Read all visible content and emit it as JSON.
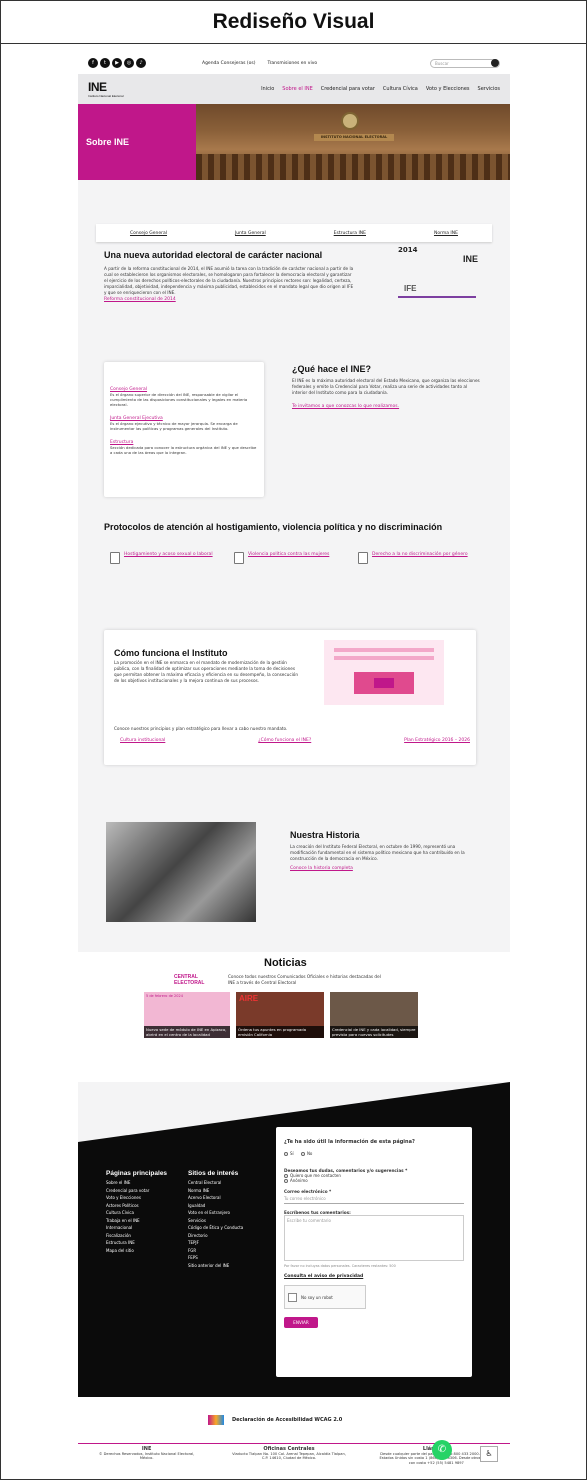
{
  "title": "Rediseño Visual",
  "utility": {
    "social_icons": [
      "facebook-icon",
      "twitter-icon",
      "youtube-icon",
      "instagram-icon",
      "tiktok-icon"
    ],
    "links": [
      "Agenda Consejeras (os)",
      "Transmisiones en vivo"
    ],
    "search_placeholder": "Buscar"
  },
  "nav": {
    "logo": "INE",
    "logo_sub": "Instituto Nacional Electoral",
    "items": [
      "Inicio",
      "Sobre el INE",
      "Credencial para votar",
      "Cultura Cívica",
      "Voto y Elecciones",
      "Servicios"
    ]
  },
  "hero": {
    "title": "Sobre INE",
    "banner_text": "INSTITUTO NACIONAL ELECTORAL"
  },
  "subtabs": [
    "Consejo General",
    "Junta General",
    "Estructura INE",
    "Norma INE"
  ],
  "intro": {
    "title": "Una nueva autoridad electoral de carácter nacional",
    "body": "A partir de la reforma constitucional de 2014, el INE asumió la tarea con la tradición de carácter nacional a partir de la cual se establecieron los organismos electorales, se homologaron para fortalecer la democracia electoral y garantizar el ejercicio de los derechos políticos-electorales de la ciudadanía. Nuestros principios rectores son: legalidad, certeza, imparcialidad, objetividad, independencia y máxima publicidad, establecidos en el mandato legal que dio origen al IFE y que se enriquecieron con el INE.",
    "link": "Reforma constitucional de 2014",
    "year": "2014",
    "ine": "INE",
    "ife": "IFE"
  },
  "que_hace": {
    "title": "¿Qué hace el INE?",
    "body": "El INE es la máxima autoridad electoral del Estado Mexicano, que organiza las elecciones federales y emite la Credencial para Votar, realiza una serie de actividades tanto al interior del Instituto como para la ciudadanía.",
    "link": "Te invitamos a que conozcas lo que realizamos.",
    "items": [
      {
        "title": "Consejo General",
        "desc": "Es el órgano superior de dirección del INE, responsable de vigilar el cumplimiento de las disposiciones constitucionales y legales en materia electoral."
      },
      {
        "title": "Junta General Ejecutiva",
        "desc": "Es el órgano ejecutivo y técnico de mayor jerarquía. Se encarga de instrumentar las políticas y programas generales del Instituto."
      },
      {
        "title": "Estructura",
        "desc": "Sección dedicada para conocer la estructura orgánica del INE y que describe a cada una de las áreas que lo integran."
      }
    ]
  },
  "protocolos": {
    "title": "Protocolos de atención al hostigamiento, violencia política y no discriminación",
    "items": [
      "Hostigamiento y acoso sexual o laboral",
      "Violencia política contra las mujeres",
      "Derecho a la no discriminación por género"
    ]
  },
  "como": {
    "title": "Cómo funciona el Instituto",
    "body": "La promoción en el INE se enmarca en el mandato de modernización de la gestión pública, con la finalidad de optimizar sus operaciones mediante la toma de decisiones que permitan obtener la máxima eficacia y eficiencia en su desempeño, la consecución de los objetivos institucionales y la mejora continua de sus procesos.",
    "sub": "Conoce nuestros principios y plan estratégico para llevar a cabo nuestro mandato.",
    "links": [
      "Cultura institucional",
      "¿Cómo funciona el INE?",
      "Plan Estratégico 2016 – 2026"
    ]
  },
  "historia": {
    "title": "Nuestra Historia",
    "body": "La creación del Instituto Federal Electoral, en octubre de 1990, representó una modificación fundamental en el sistema político mexicano que ha contribuido en la construcción de la democracia en México.",
    "link": "Conoce la historia completa"
  },
  "noticias": {
    "title": "Noticias",
    "brand": "CENTRAL ELECTORAL",
    "desc": "Conoce todos nuestros Comunicados Oficiales e historias destacadas del INE a través de Central Electoral",
    "items": [
      {
        "tag": "5 de febrero de 2024",
        "caption": "Nuevo sede de módulo de INE en Apizaco, abrirá en el centro de la localidad",
        "color": "#d76aa8"
      },
      {
        "tag": "AIRE",
        "caption": "Órdena tus apuntes en programada emisión California",
        "color": "#7a3a2a"
      },
      {
        "tag": "",
        "caption": "Credencial de INE y cada localidad, siempre prevista para nuevas solicitudes",
        "color": "#6c5848"
      }
    ]
  },
  "footer": {
    "col1_title": "Páginas principales",
    "col1": [
      "Sobre el INE",
      "Credencial para votar",
      "Voto y Elecciones",
      "Actores Políticos",
      "Cultura Cívica",
      "Trabaja en el INE",
      "Internacional",
      "Fiscalización",
      "Estructura INE",
      "Mapa del sitio"
    ],
    "col2_title": "Sitios de interés",
    "col2": [
      "Central Electoral",
      "Norma INE",
      "Acervo Electoral",
      "Igualdad",
      "Voto en el Extranjero",
      "Servicios",
      "Código de Ética y Conducta",
      "Directorio",
      "TEPJF",
      "FGR",
      "FEPS",
      "Sitio anterior del INE"
    ],
    "survey": {
      "question": "¿Te ha sido útil la información de esta página?",
      "yes": "Sí",
      "no": "No",
      "comments_label": "Deseamos tus dudas, comentarios y/o sugerencias *",
      "opt1": "Quiero que me contacten",
      "opt2": "Anónimo",
      "email_label": "Correo electrónico *",
      "email_placeholder": "Tu correo electrónico",
      "comment_label": "Escríbenos tus comentarios:",
      "comment_placeholder": "Escribe tu comentario",
      "hint": "Por favor no incluyas datos personales. Caracteres restantes: 500",
      "privacy": "Consulta el aviso de privacidad",
      "captcha": "No soy un robot",
      "send": "ENVIAR"
    }
  },
  "bottom": {
    "accessibility": "Declaración de Accesibilidad WCAG 2.0",
    "cols": [
      {
        "title": "INE",
        "text": "© Derechos Reservados, Instituto Nacional Electoral, México."
      },
      {
        "title": "Oficinas Centrales",
        "text": "Viaducto Tlalpan No. 100 Col. Arenal Tepepan, Alcaldía Tlalpan, C.P. 14610, Ciudad de México."
      },
      {
        "title": "Llámanos",
        "text": "Desde cualquier parte del país sin costo 800 433 2000. Desde Estados Unidos sin costo 1 (866) 986 8306. Desde otros países con costo +52 (55) 5481 9897"
      }
    ]
  }
}
